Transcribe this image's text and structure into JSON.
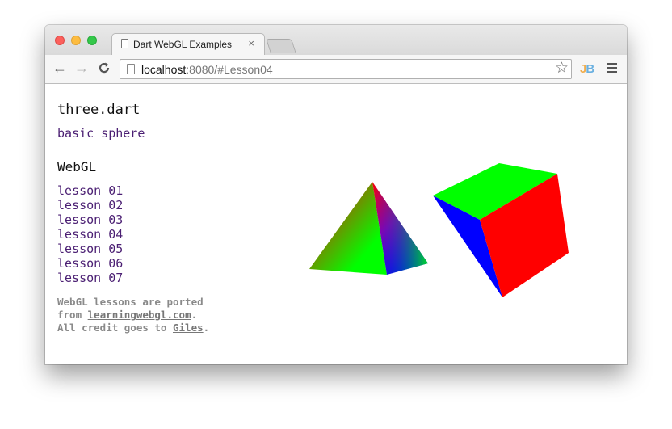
{
  "browser": {
    "tab_title": "Dart WebGL Examples",
    "tab_close": "×",
    "url_host": "localhost",
    "url_rest": ":8080/#Lesson04",
    "bookmark_star": "☆",
    "back": "←",
    "forward": "→",
    "reload": "C",
    "extension_label_j": "J",
    "extension_label_b": "B"
  },
  "sidebar": {
    "heading_three": "three.dart",
    "link_sphere": "basic sphere",
    "heading_webgl": "WebGL",
    "lessons": [
      "lesson 01",
      "lesson 02",
      "lesson 03",
      "lesson 04",
      "lesson 05",
      "lesson 06",
      "lesson 07"
    ],
    "footnote": {
      "line1": "WebGL lessons are ported",
      "line2_prefix": "from ",
      "line2_link": "learningwebgl.com",
      "line2_suffix": ".",
      "line3_prefix": "All credit goes to ",
      "line3_link": "Giles",
      "line3_suffix": "."
    }
  },
  "scene": {
    "colors": {
      "red": "#ff0000",
      "green": "#00ff00",
      "blue": "#0000ff"
    }
  }
}
